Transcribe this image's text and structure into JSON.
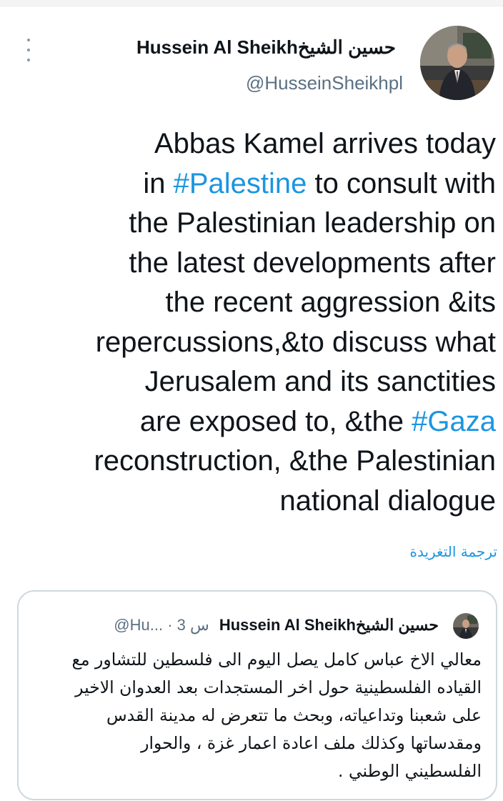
{
  "colors": {
    "accent": "#1b95e0",
    "text": "#0f1419",
    "secondary": "#5b7083",
    "border": "#cfd9de"
  },
  "icons": {
    "more": "more-vertical-icon"
  },
  "author": {
    "display_name_en": "Hussein Al Sheikh",
    "display_name_ar": "حسين الشيخ",
    "handle": "@HusseinSheikhpl"
  },
  "tweet": {
    "lines": [
      [
        "Abbas Kamel arrives today"
      ],
      [
        "in ",
        "#Palestine",
        " to consult with"
      ],
      [
        "the Palestinian leadership on"
      ],
      [
        "the latest developments after"
      ],
      [
        "the recent aggression &its"
      ],
      [
        "repercussions,&to discuss what"
      ],
      [
        "Jerusalem and its sanctities"
      ],
      [
        "are exposed to, &the ",
        "#Gaza"
      ],
      [
        "reconstruction, &the Palestinian"
      ],
      [
        "national dialogue"
      ]
    ],
    "translate_label": "ترجمة التغريدة"
  },
  "quoted_tweet": {
    "display_name_en": "Hussein Al Sheikh",
    "display_name_ar": "حسين الشيخ",
    "handle_truncated": "@Hu...",
    "time": "3 س",
    "lines": [
      "معالي الاخ عباس كامل يصل اليوم الى فلسطين للتشاور مع",
      "القياده الفلسطينية حول اخر المستجدات بعد العدوان الاخير",
      "على شعبنا وتداعياته، وبحث ما تتعرض له مدينة القدس",
      "ومقدساتها وكذلك ملف اعادة اعمار غزة ، والحوار",
      "الفلسطيني الوطني ."
    ]
  }
}
